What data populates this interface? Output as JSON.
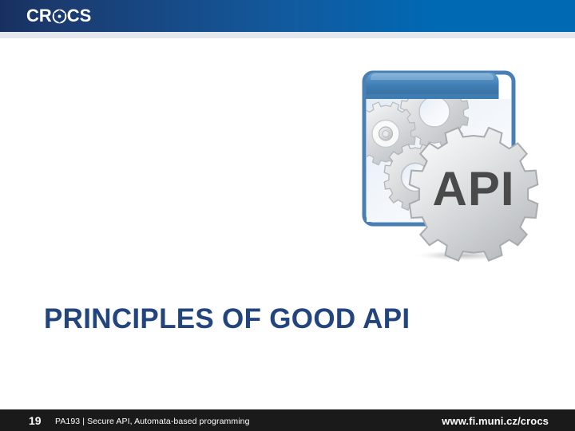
{
  "header": {
    "logo": {
      "text_before": "CR",
      "mark_icon": "crocs-target-icon",
      "text_after": "CS",
      "full_text": "CROCS"
    },
    "gradient_from": "#17305f",
    "gradient_to": "#0069b4",
    "underline_color": "#e4e7ec"
  },
  "graphic": {
    "name": "api-window-gears-illustration",
    "gear_label": "API",
    "window_titlebar_color": "#3d7cb5",
    "window_border_color": "#4a7fb5",
    "window_panel_color": "#eef3f9",
    "gear_fill_color": "#d2d4d6",
    "gear_text_color": "#4a4a4a"
  },
  "title": {
    "text": "PRINCIPLES OF GOOD API",
    "color": "#23457e"
  },
  "footer": {
    "slide_number": "19",
    "course_label": "PA193 | Secure API, Automata-based programming",
    "url": "www.fi.muni.cz/crocs",
    "background_color": "#1a1a1a"
  }
}
